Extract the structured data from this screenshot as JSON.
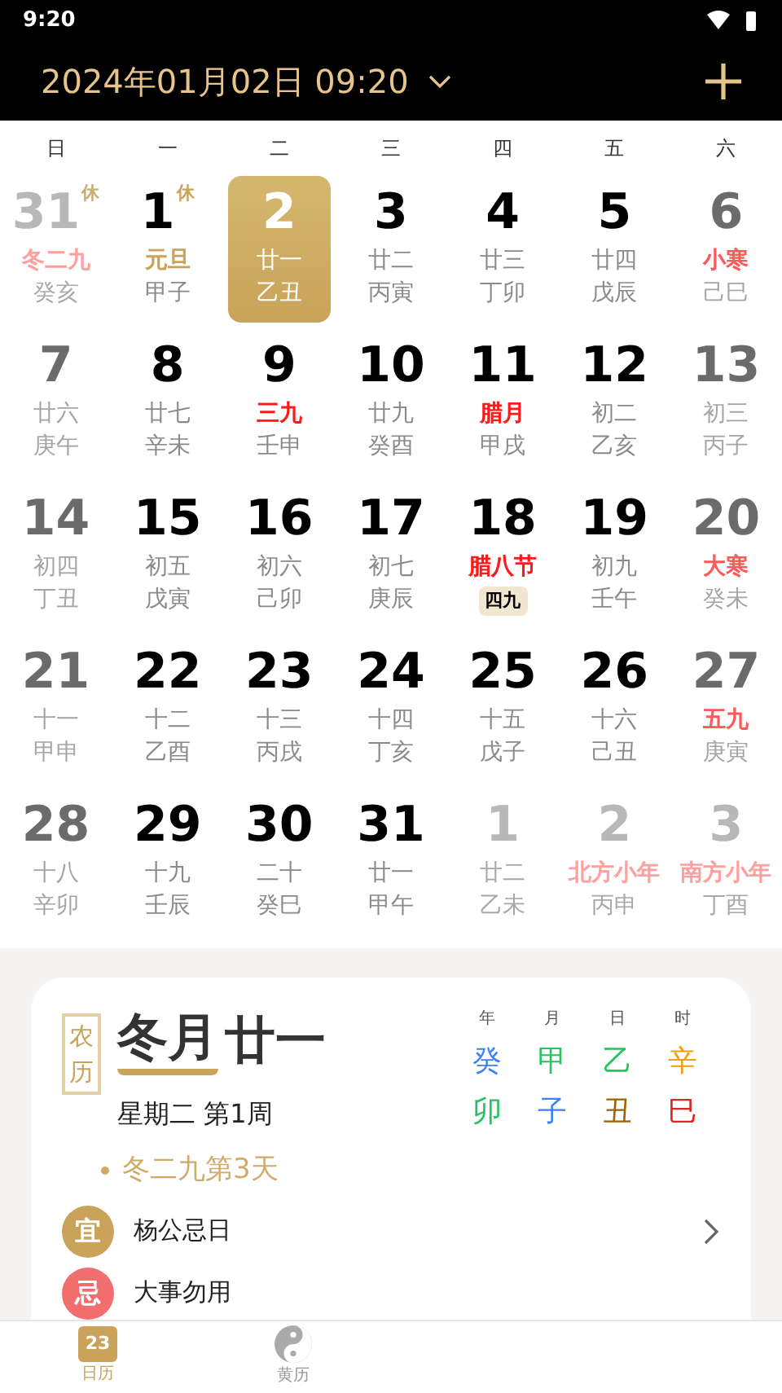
{
  "status_bar": {
    "time": "9:20"
  },
  "header": {
    "date": "2024年01月02日 09:20"
  },
  "weekdays": [
    "日",
    "一",
    "二",
    "三",
    "四",
    "五",
    "六"
  ],
  "days": [
    {
      "day": "31",
      "lunar": "冬二九",
      "ganzhi": "癸亥",
      "other_month": true,
      "weekend": true,
      "selected": false,
      "color": "#ff9f9f",
      "rest": "休"
    },
    {
      "day": "1",
      "lunar": "元旦",
      "ganzhi": "甲子",
      "other_month": false,
      "weekend": false,
      "selected": false,
      "color": "#c9a35a",
      "rest": "休"
    },
    {
      "day": "2",
      "lunar": "廿一",
      "ganzhi": "乙丑",
      "other_month": false,
      "weekend": false,
      "selected": true
    },
    {
      "day": "3",
      "lunar": "廿二",
      "ganzhi": "丙寅",
      "other_month": false,
      "weekend": false,
      "selected": false
    },
    {
      "day": "4",
      "lunar": "廿三",
      "ganzhi": "丁卯",
      "other_month": false,
      "weekend": false,
      "selected": false
    },
    {
      "day": "5",
      "lunar": "廿四",
      "ganzhi": "戊辰",
      "other_month": false,
      "weekend": false,
      "selected": false
    },
    {
      "day": "6",
      "lunar": "小寒",
      "ganzhi": "己巳",
      "other_month": false,
      "weekend": true,
      "selected": false,
      "color": "#ff5a5a"
    },
    {
      "day": "7",
      "lunar": "廿六",
      "ganzhi": "庚午",
      "other_month": false,
      "weekend": true,
      "selected": false
    },
    {
      "day": "8",
      "lunar": "廿七",
      "ganzhi": "辛未",
      "other_month": false,
      "weekend": false,
      "selected": false
    },
    {
      "day": "9",
      "lunar": "三九",
      "ganzhi": "壬申",
      "other_month": false,
      "weekend": false,
      "selected": false,
      "color": "#ff1a1a"
    },
    {
      "day": "10",
      "lunar": "廿九",
      "ganzhi": "癸酉",
      "other_month": false,
      "weekend": false,
      "selected": false
    },
    {
      "day": "11",
      "lunar": "腊月",
      "ganzhi": "甲戌",
      "other_month": false,
      "weekend": false,
      "selected": false,
      "color": "#ff1a1a"
    },
    {
      "day": "12",
      "lunar": "初二",
      "ganzhi": "乙亥",
      "other_month": false,
      "weekend": false,
      "selected": false
    },
    {
      "day": "13",
      "lunar": "初三",
      "ganzhi": "丙子",
      "other_month": false,
      "weekend": true,
      "selected": false
    },
    {
      "day": "14",
      "lunar": "初四",
      "ganzhi": "丁丑",
      "other_month": false,
      "weekend": true,
      "selected": false
    },
    {
      "day": "15",
      "lunar": "初五",
      "ganzhi": "戊寅",
      "other_month": false,
      "weekend": false,
      "selected": false
    },
    {
      "day": "16",
      "lunar": "初六",
      "ganzhi": "己卯",
      "other_month": false,
      "weekend": false,
      "selected": false
    },
    {
      "day": "17",
      "lunar": "初七",
      "ganzhi": "庚辰",
      "other_month": false,
      "weekend": false,
      "selected": false
    },
    {
      "day": "18",
      "lunar": "腊八节",
      "tag": "四九",
      "other_month": false,
      "weekend": false,
      "selected": false,
      "color": "#ff1a1a"
    },
    {
      "day": "19",
      "lunar": "初九",
      "ganzhi": "壬午",
      "other_month": false,
      "weekend": false,
      "selected": false
    },
    {
      "day": "20",
      "lunar": "大寒",
      "ganzhi": "癸未",
      "other_month": false,
      "weekend": true,
      "selected": false,
      "color": "#ff5a5a"
    },
    {
      "day": "21",
      "lunar": "十一",
      "ganzhi": "甲申",
      "other_month": false,
      "weekend": true,
      "selected": false
    },
    {
      "day": "22",
      "lunar": "十二",
      "ganzhi": "乙酉",
      "other_month": false,
      "weekend": false,
      "selected": false
    },
    {
      "day": "23",
      "lunar": "十三",
      "ganzhi": "丙戌",
      "other_month": false,
      "weekend": false,
      "selected": false
    },
    {
      "day": "24",
      "lunar": "十四",
      "ganzhi": "丁亥",
      "other_month": false,
      "weekend": false,
      "selected": false
    },
    {
      "day": "25",
      "lunar": "十五",
      "ganzhi": "戊子",
      "other_month": false,
      "weekend": false,
      "selected": false
    },
    {
      "day": "26",
      "lunar": "十六",
      "ganzhi": "己丑",
      "other_month": false,
      "weekend": false,
      "selected": false
    },
    {
      "day": "27",
      "lunar": "五九",
      "ganzhi": "庚寅",
      "other_month": false,
      "weekend": true,
      "selected": false,
      "color": "#ff5a5a"
    },
    {
      "day": "28",
      "lunar": "十八",
      "ganzhi": "辛卯",
      "other_month": false,
      "weekend": true,
      "selected": false
    },
    {
      "day": "29",
      "lunar": "十九",
      "ganzhi": "壬辰",
      "other_month": false,
      "weekend": false,
      "selected": false
    },
    {
      "day": "30",
      "lunar": "二十",
      "ganzhi": "癸巳",
      "other_month": false,
      "weekend": false,
      "selected": false
    },
    {
      "day": "31",
      "lunar": "廿一",
      "ganzhi": "甲午",
      "other_month": false,
      "weekend": false,
      "selected": false
    },
    {
      "day": "1",
      "lunar": "廿二",
      "ganzhi": "乙未",
      "other_month": true,
      "weekend": false,
      "selected": false
    },
    {
      "day": "2",
      "lunar": "北方小年",
      "ganzhi": "丙申",
      "other_month": true,
      "weekend": false,
      "selected": false,
      "color": "#ff9f9f"
    },
    {
      "day": "3",
      "lunar": "南方小年",
      "ganzhi": "丁酉",
      "other_month": true,
      "weekend": true,
      "selected": false,
      "color": "#ff9f9f"
    }
  ],
  "detail": {
    "badge": "农历",
    "month": "冬月",
    "day": "廿一",
    "weekday": "星期二 第1周",
    "note": "冬二九第3天",
    "pillar_heads": [
      "年",
      "月",
      "日",
      "时"
    ],
    "stems": [
      {
        "text": "癸",
        "color": "#3b82f6"
      },
      {
        "text": "甲",
        "color": "#22c55e"
      },
      {
        "text": "乙",
        "color": "#22c55e"
      },
      {
        "text": "辛",
        "color": "#f59e0b"
      }
    ],
    "branches": [
      {
        "text": "卯",
        "color": "#22c55e"
      },
      {
        "text": "子",
        "color": "#3b82f6"
      },
      {
        "text": "丑",
        "color": "#a16207"
      },
      {
        "text": "巳",
        "color": "#dc2626"
      }
    ],
    "items": [
      {
        "kind": "good",
        "mark": "宜",
        "text": "杨公忌日"
      },
      {
        "kind": "bad",
        "mark": "忌",
        "text": "大事勿用"
      }
    ]
  },
  "nav": [
    {
      "label": "日历",
      "icon_text": "23",
      "selected": true,
      "kind": "calendar"
    },
    {
      "label": "黄历",
      "selected": false,
      "kind": "yinyang"
    }
  ]
}
